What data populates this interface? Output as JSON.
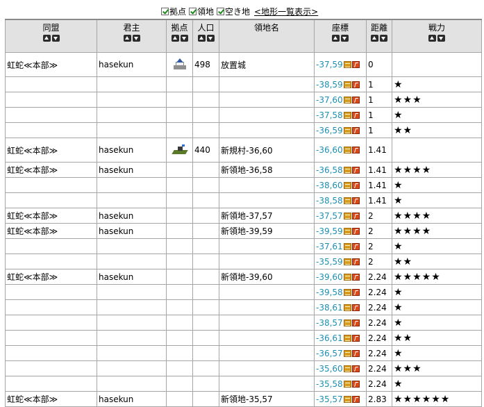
{
  "filters": {
    "items": [
      {
        "label": "拠点",
        "checked": true
      },
      {
        "label": "領地",
        "checked": true
      },
      {
        "label": "空き地",
        "checked": true
      }
    ],
    "link": "<地形一覧表示>"
  },
  "columns": [
    "同盟",
    "君主",
    "拠点",
    "人口",
    "領地名",
    "座標",
    "距離",
    "戦力"
  ],
  "rows": [
    {
      "alliance": "虹蛇≪本部≫",
      "lord": "hasekun",
      "icon": "castle-icon",
      "pop": "498",
      "name": "放置城",
      "coord": "-37,59",
      "dist": "0",
      "stars": "",
      "tall": true
    },
    {
      "alliance": "",
      "lord": "",
      "icon": "",
      "pop": "",
      "name": "",
      "coord": "-38,59",
      "dist": "1",
      "stars": "★",
      "tall": false
    },
    {
      "alliance": "",
      "lord": "",
      "icon": "",
      "pop": "",
      "name": "",
      "coord": "-37,60",
      "dist": "1",
      "stars": "★★★",
      "tall": false
    },
    {
      "alliance": "",
      "lord": "",
      "icon": "",
      "pop": "",
      "name": "",
      "coord": "-37,58",
      "dist": "1",
      "stars": "★",
      "tall": false
    },
    {
      "alliance": "",
      "lord": "",
      "icon": "",
      "pop": "",
      "name": "",
      "coord": "-36,59",
      "dist": "1",
      "stars": "★★",
      "tall": false
    },
    {
      "alliance": "虹蛇≪本部≫",
      "lord": "hasekun",
      "icon": "village-icon",
      "pop": "440",
      "name": "新規村-36,60",
      "coord": "-36,60",
      "dist": "1.41",
      "stars": "",
      "tall": true
    },
    {
      "alliance": "虹蛇≪本部≫",
      "lord": "hasekun",
      "icon": "",
      "pop": "",
      "name": "新領地-36,58",
      "coord": "-36,58",
      "dist": "1.41",
      "stars": "★★★★",
      "tall": false
    },
    {
      "alliance": "",
      "lord": "",
      "icon": "",
      "pop": "",
      "name": "",
      "coord": "-38,60",
      "dist": "1.41",
      "stars": "★",
      "tall": false
    },
    {
      "alliance": "",
      "lord": "",
      "icon": "",
      "pop": "",
      "name": "",
      "coord": "-38,58",
      "dist": "1.41",
      "stars": "★",
      "tall": false
    },
    {
      "alliance": "虹蛇≪本部≫",
      "lord": "hasekun",
      "icon": "",
      "pop": "",
      "name": "新領地-37,57",
      "coord": "-37,57",
      "dist": "2",
      "stars": "★★★★",
      "tall": false
    },
    {
      "alliance": "虹蛇≪本部≫",
      "lord": "hasekun",
      "icon": "",
      "pop": "",
      "name": "新領地-39,59",
      "coord": "-39,59",
      "dist": "2",
      "stars": "★★★★",
      "tall": false
    },
    {
      "alliance": "",
      "lord": "",
      "icon": "",
      "pop": "",
      "name": "",
      "coord": "-37,61",
      "dist": "2",
      "stars": "★",
      "tall": false
    },
    {
      "alliance": "",
      "lord": "",
      "icon": "",
      "pop": "",
      "name": "",
      "coord": "-35,59",
      "dist": "2",
      "stars": "★★",
      "tall": false
    },
    {
      "alliance": "虹蛇≪本部≫",
      "lord": "hasekun",
      "icon": "",
      "pop": "",
      "name": "新領地-39,60",
      "coord": "-39,60",
      "dist": "2.24",
      "stars": "★★★★★",
      "tall": false
    },
    {
      "alliance": "",
      "lord": "",
      "icon": "",
      "pop": "",
      "name": "",
      "coord": "-39,58",
      "dist": "2.24",
      "stars": "★",
      "tall": false
    },
    {
      "alliance": "",
      "lord": "",
      "icon": "",
      "pop": "",
      "name": "",
      "coord": "-38,61",
      "dist": "2.24",
      "stars": "★",
      "tall": false
    },
    {
      "alliance": "",
      "lord": "",
      "icon": "",
      "pop": "",
      "name": "",
      "coord": "-38,57",
      "dist": "2.24",
      "stars": "★",
      "tall": false
    },
    {
      "alliance": "",
      "lord": "",
      "icon": "",
      "pop": "",
      "name": "",
      "coord": "-36,61",
      "dist": "2.24",
      "stars": "★★",
      "tall": false
    },
    {
      "alliance": "",
      "lord": "",
      "icon": "",
      "pop": "",
      "name": "",
      "coord": "-36,57",
      "dist": "2.24",
      "stars": "★",
      "tall": false
    },
    {
      "alliance": "",
      "lord": "",
      "icon": "",
      "pop": "",
      "name": "",
      "coord": "-35,60",
      "dist": "2.24",
      "stars": "★★★",
      "tall": false
    },
    {
      "alliance": "",
      "lord": "",
      "icon": "",
      "pop": "",
      "name": "",
      "coord": "-35,58",
      "dist": "2.24",
      "stars": "★",
      "tall": false
    },
    {
      "alliance": "虹蛇≪本部≫",
      "lord": "hasekun",
      "icon": "",
      "pop": "",
      "name": "新領地-35,57",
      "coord": "-35,57",
      "dist": "2.83",
      "stars": "★★★★★★",
      "tall": false
    }
  ]
}
